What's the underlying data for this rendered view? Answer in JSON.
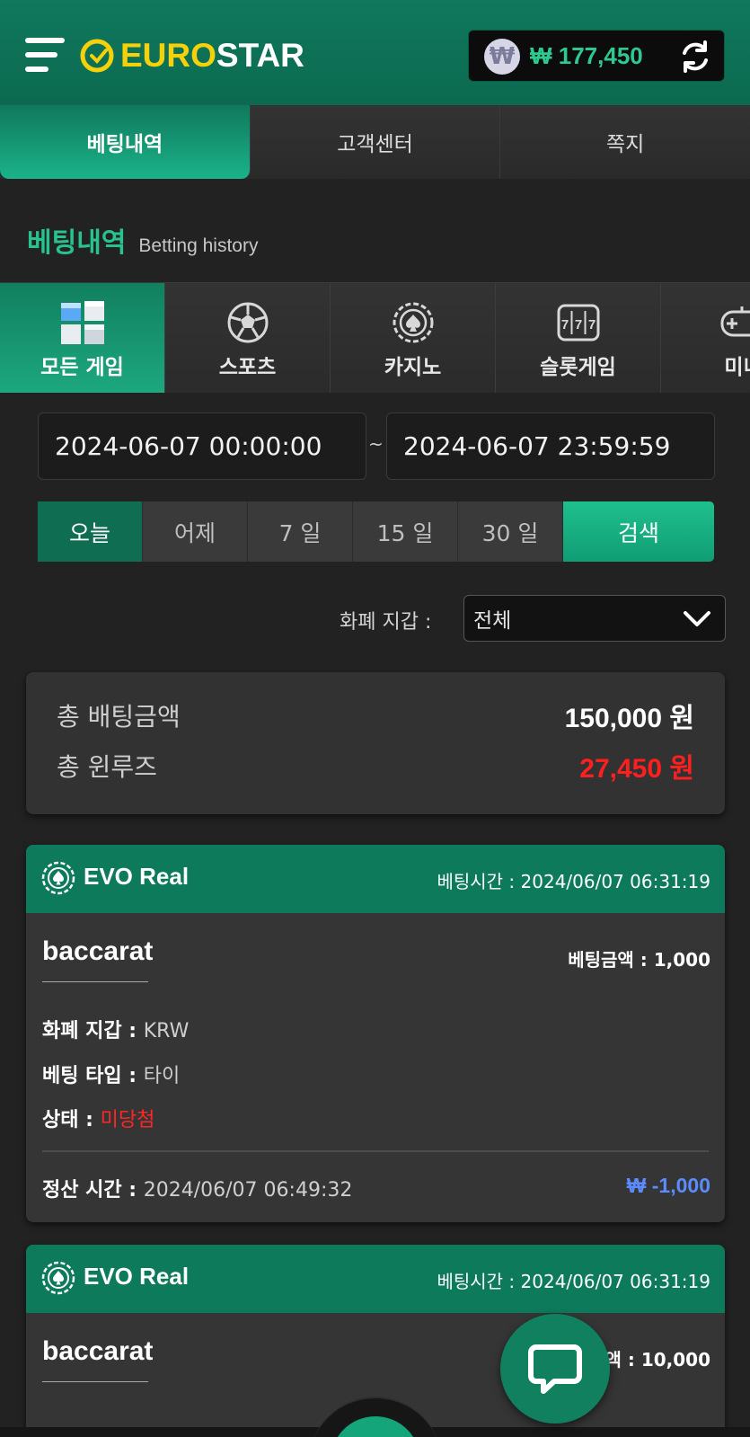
{
  "header": {
    "logo_text_euro": "EURO",
    "logo_text_star": "STAR",
    "currency_symbol": "₩",
    "balance": "₩ 177,450"
  },
  "top_tabs": [
    {
      "label": "베팅내역",
      "active": true
    },
    {
      "label": "고객센터",
      "active": false
    },
    {
      "label": "쪽지",
      "active": false
    }
  ],
  "section": {
    "title_ko": "베팅내역",
    "title_en": "Betting history"
  },
  "game_tabs": [
    {
      "label": "모든 게임",
      "icon": "cubes-icon",
      "active": true
    },
    {
      "label": "스포츠",
      "icon": "soccer-ball-icon",
      "active": false
    },
    {
      "label": "카지노",
      "icon": "casino-chip-icon",
      "active": false
    },
    {
      "label": "슬롯게임",
      "icon": "slot-machine-icon",
      "active": false
    },
    {
      "label": "미니",
      "icon": "gamepad-icon",
      "active": false
    }
  ],
  "date_range": {
    "from": "2024-06-07 00:00:00",
    "separator": "~",
    "to": "2024-06-07 23:59:59"
  },
  "quick_ranges": [
    {
      "label": "오늘",
      "active": true
    },
    {
      "label": "어제",
      "active": false
    },
    {
      "label": "7 일",
      "active": false
    },
    {
      "label": "15 일",
      "active": false
    },
    {
      "label": "30 일",
      "active": false
    }
  ],
  "search_label": "검색",
  "currency_filter": {
    "label": "화폐 지갑 :",
    "selected": "전체"
  },
  "summary": {
    "total_bet_label": "총 배팅금액",
    "total_bet_value": "150,000 원",
    "total_winloss_label": "총 윈루즈",
    "total_winloss_value": "27,450 원"
  },
  "bets": [
    {
      "provider": "EVO Real",
      "bet_time_label": "베팅시간 :",
      "bet_time": "2024/06/07 06:31:19",
      "game": "baccarat",
      "bet_amount_label": "베팅금액 :",
      "bet_amount": "1,000",
      "wallet_label": "화폐 지갑 :",
      "wallet": "KRW",
      "bet_type_label": "베팅 타입 :",
      "bet_type": "타이",
      "status_label": "상태 :",
      "status": "미당첨",
      "settle_label": "정산 시간 :",
      "settle_time": "2024/06/07 06:49:32",
      "payout": "₩ -1,000"
    },
    {
      "provider": "EVO Real",
      "bet_time_label": "베팅시간 :",
      "bet_time": "2024/06/07 06:31:19",
      "game": "baccarat",
      "bet_amount_label": "금액 :",
      "bet_amount": "10,000"
    }
  ],
  "colors": {
    "brand_green": "#0d7a5b",
    "accent_green": "#1fbf8d",
    "logo_yellow": "#f5d10c",
    "loss_red": "#ff1f1f",
    "payout_blue": "#5a8cff",
    "background": "#222222"
  }
}
